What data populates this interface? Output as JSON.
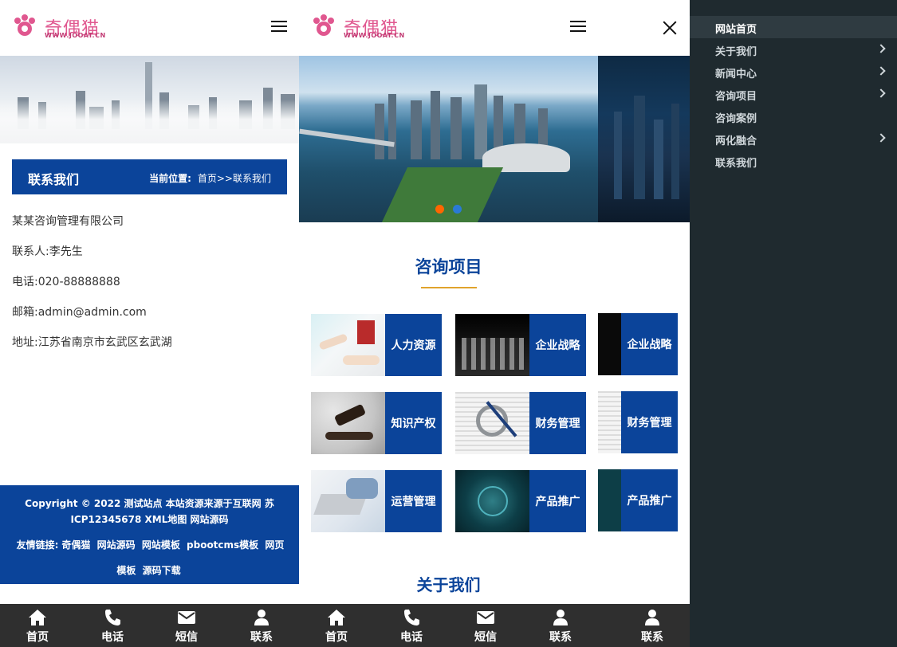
{
  "brand": {
    "name": "奇偶猫",
    "url": "WWW.JOOAT.CN",
    "pink": "#e0578f"
  },
  "colors": {
    "primary": "#0b449a",
    "accent": "#e0a32c",
    "dot_active": "#ff6600",
    "dot_inactive": "#2a7ad5",
    "sidebar": "#1f2a2f",
    "tabbar": "#2f2f2f"
  },
  "contact_page": {
    "title": "联系我们",
    "breadcrumb_label": "当前位置:",
    "breadcrumb": "首页>>联系我们",
    "company": "某某咨询管理有限公司",
    "contact": "联系人:李先生",
    "phone": "电话:020-88888888",
    "email": "邮箱:admin@admin.com",
    "address": "地址:江苏省南京市玄武区玄武湖"
  },
  "footer": {
    "copyright": "Copyright © 2022 测试站点 本站资源来源于互联网 苏ICP12345678 XML地图 网站源码",
    "links_label": "友情链接:",
    "links": [
      "奇偶猫",
      "网站源码",
      "网站模板",
      "pbootcms模板",
      "网页模板",
      "源码下载"
    ]
  },
  "tabbar": [
    {
      "label": "首页",
      "icon": "home-icon"
    },
    {
      "label": "电话",
      "icon": "phone-icon"
    },
    {
      "label": "短信",
      "icon": "envelope-icon"
    },
    {
      "label": "联系",
      "icon": "user-icon"
    }
  ],
  "home": {
    "services_title": "咨询项目",
    "services": [
      {
        "label": "人力资源",
        "icon": "contract-photo"
      },
      {
        "label": "企业战略",
        "icon": "chess-photo"
      },
      {
        "label": "知识产权",
        "icon": "gavel-photo"
      },
      {
        "label": "财务管理",
        "icon": "magnifier-photo"
      },
      {
        "label": "运营管理",
        "icon": "laptop-photo"
      },
      {
        "label": "产品推广",
        "icon": "circuit-photo"
      }
    ],
    "about_title": "关于我们"
  },
  "sidebar": {
    "items": [
      {
        "label": "网站首页",
        "has_children": false,
        "active": true
      },
      {
        "label": "关于我们",
        "has_children": true,
        "active": false
      },
      {
        "label": "新闻中心",
        "has_children": true,
        "active": false
      },
      {
        "label": "咨询项目",
        "has_children": true,
        "active": false
      },
      {
        "label": "咨询案例",
        "has_children": false,
        "active": false
      },
      {
        "label": "两化融合",
        "has_children": true,
        "active": false
      },
      {
        "label": "联系我们",
        "has_children": false,
        "active": false
      }
    ]
  }
}
